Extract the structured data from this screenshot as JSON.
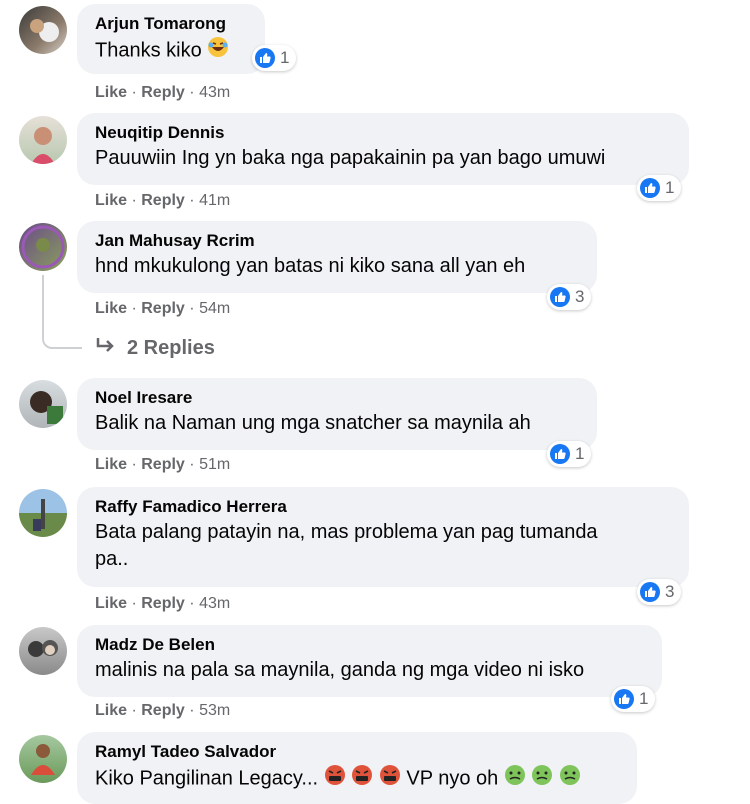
{
  "actions": {
    "like": "Like",
    "sep": "·",
    "reply": "Reply"
  },
  "comments": [
    {
      "author": "Arjun Tomarong",
      "text": "Thanks kiko",
      "reactions": "1",
      "time": "43m"
    },
    {
      "author": "Neuqitip Dennis",
      "text": "Pauuwiin Ing yn baka nga papakainin pa yan bago umuwi",
      "reactions": "1",
      "time": "41m"
    },
    {
      "author": "Jan Mahusay Rcrim",
      "text": "hnd mkukulong yan batas ni kiko sana all yan eh",
      "reactions": "3",
      "time": "54m"
    },
    {
      "author": "Noel Iresare",
      "text": "Balik na Naman ung mga snatcher sa maynila ah",
      "reactions": "1",
      "time": "51m"
    },
    {
      "author": "Raffy Famadico Herrera",
      "text": "Bata palang patayin na, mas problema yan pag tumanda",
      "text2": "pa..",
      "reactions": "3",
      "time": "43m"
    },
    {
      "author": "Madz De Belen",
      "text": "malinis na pala sa maynila, ganda ng mga video ni isko",
      "reactions": "1",
      "time": "53m"
    },
    {
      "author": "Ramyl Tadeo Salvador",
      "text": "Kiko Pangilinan Legacy...",
      "text_after": "VP nyo oh"
    }
  ],
  "view_replies": "2 Replies",
  "colors": {
    "bubble": "#f0f2f5",
    "like_blue": "#1877f2",
    "meta_gray": "#65676b"
  }
}
